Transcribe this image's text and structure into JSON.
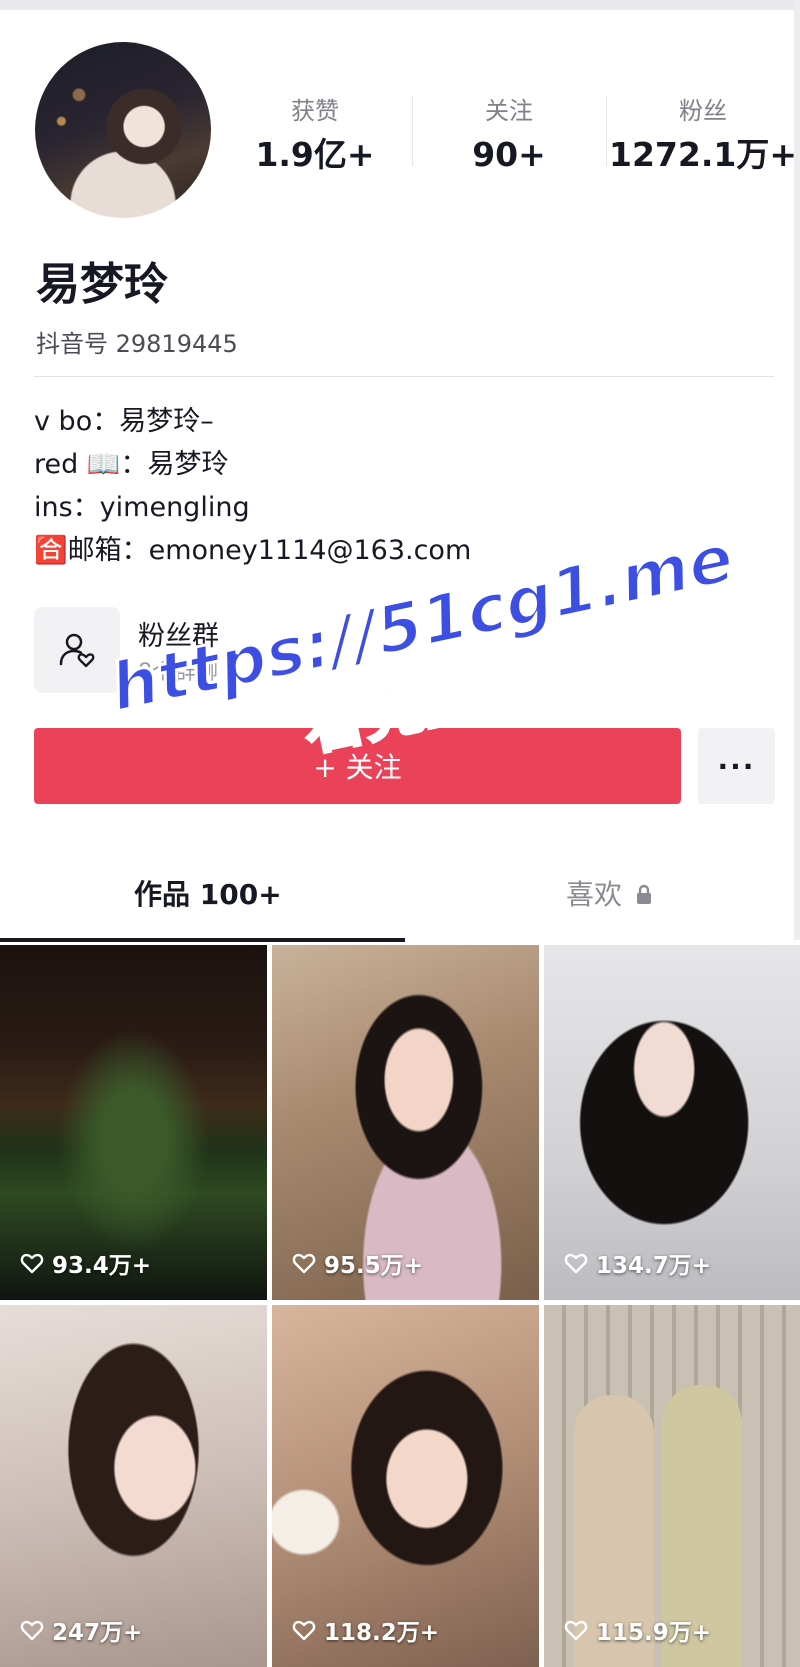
{
  "profile": {
    "name": "易梦玲",
    "account_id": "抖音号 29819445"
  },
  "stats": [
    {
      "label": "获赞",
      "value": "1.9亿+"
    },
    {
      "label": "关注",
      "value": "90+"
    },
    {
      "label": "粉丝",
      "value": "1272.1万+"
    }
  ],
  "bio": {
    "line1": "v bo：易梦玲–",
    "line2": "red 📖：易梦玲",
    "line3": "ins：yimengling",
    "line4": "🈴邮箱：emoney1114@163.com"
  },
  "fan_group": {
    "title": "粉丝群",
    "subtitle": "8个群聊"
  },
  "actions": {
    "follow_label": "+ 关注",
    "more_label": "···"
  },
  "tabs": {
    "works": "作品 100+",
    "likes": "喜欢"
  },
  "videos": [
    {
      "likes": "93.4万+"
    },
    {
      "likes": "95.5万+"
    },
    {
      "likes": "134.7万+"
    },
    {
      "likes": "247万+"
    },
    {
      "likes": "118.2万+"
    },
    {
      "likes": "115.9万+"
    }
  ],
  "watermark": {
    "line1": "https://51cg1.me",
    "line2": "看完整版"
  },
  "colors": {
    "follow_button": "#ea4359",
    "watermark": "#3d4fe3"
  }
}
